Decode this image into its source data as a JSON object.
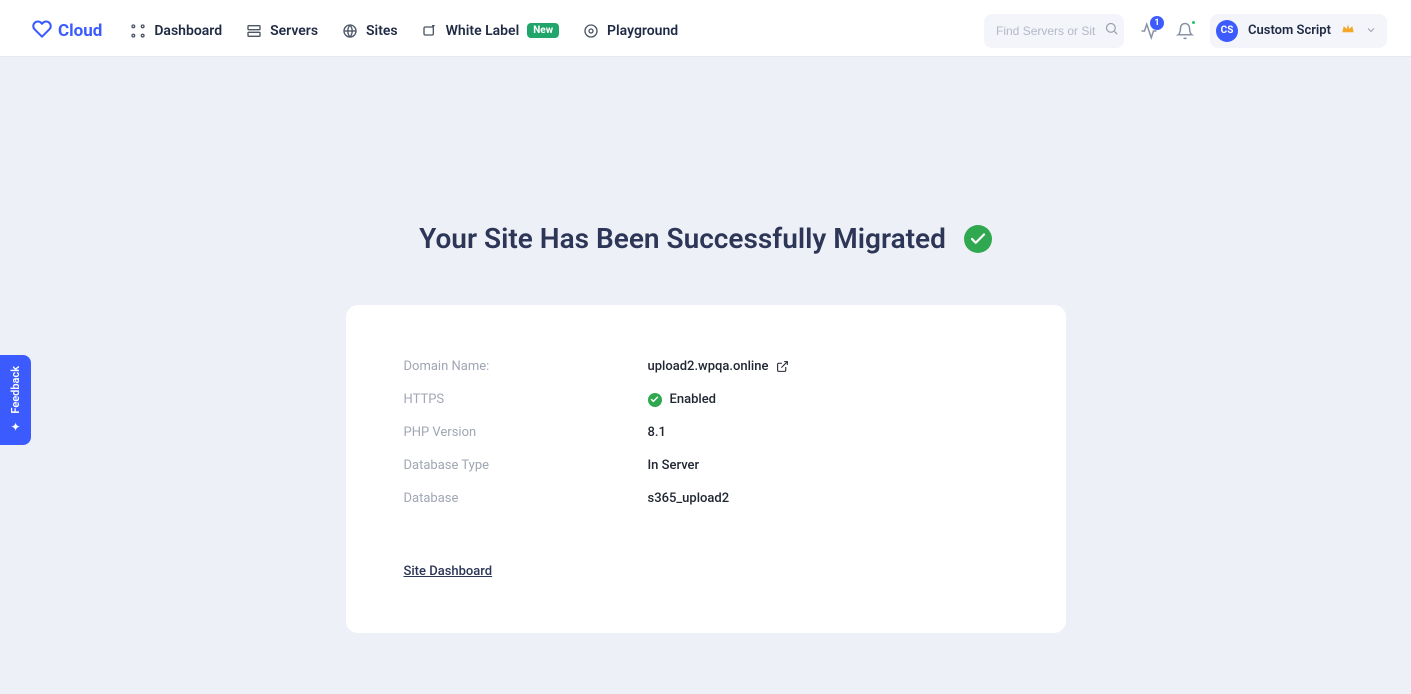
{
  "brand": {
    "name": "Cloud"
  },
  "nav": {
    "dashboard": "Dashboard",
    "servers": "Servers",
    "sites": "Sites",
    "whitelabel": "White Label",
    "whitelabel_badge": "New",
    "playground": "Playground"
  },
  "search": {
    "placeholder": "Find Servers or Sites"
  },
  "activity_badge": "1",
  "user": {
    "initials": "CS",
    "name": "Custom Script"
  },
  "page": {
    "title": "Your Site Has Been Successfully Migrated",
    "rows": {
      "domain_label": "Domain Name:",
      "domain_value": "upload2.wpqa.online",
      "https_label": "HTTPS",
      "https_value": "Enabled",
      "php_label": "PHP Version",
      "php_value": "8.1",
      "dbtype_label": "Database Type",
      "dbtype_value": "In Server",
      "db_label": "Database",
      "db_value": "s365_upload2"
    },
    "dashboard_link": "Site Dashboard"
  },
  "feedback": {
    "label": "Feedback"
  }
}
